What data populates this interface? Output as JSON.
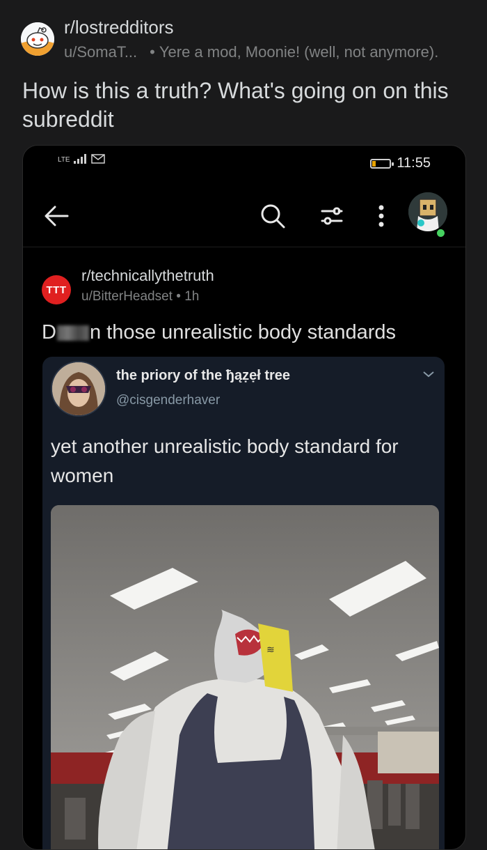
{
  "outer_post": {
    "subreddit": "r/lostredditors",
    "user": "u/SomaT...",
    "flair": "Yere a mod, Moonie! (well, not anymore).",
    "title": "How is this a truth? What's going on on this subreddit"
  },
  "phone": {
    "status": {
      "network": "LTE",
      "time": "11:55"
    },
    "app_bar": {
      "icons": [
        "back-arrow-icon",
        "search-icon",
        "filter-icon",
        "more-icon",
        "avatar"
      ]
    },
    "post": {
      "subreddit_icon_text": "TTT",
      "subreddit": "r/technicallythetruth",
      "user": "u/BitterHeadset",
      "age": "1h",
      "title_start": "D",
      "title_end": "n those unrealistic body standards"
    },
    "tweet": {
      "name": "the priory of the ђąẓẹł tree",
      "handle": "@cisgenderhaver",
      "text": "yet another unrealistic body standard for women"
    }
  },
  "colors": {
    "accent_red": "#e02020",
    "online_green": "#46d160",
    "tweet_bg": "#151c28"
  }
}
